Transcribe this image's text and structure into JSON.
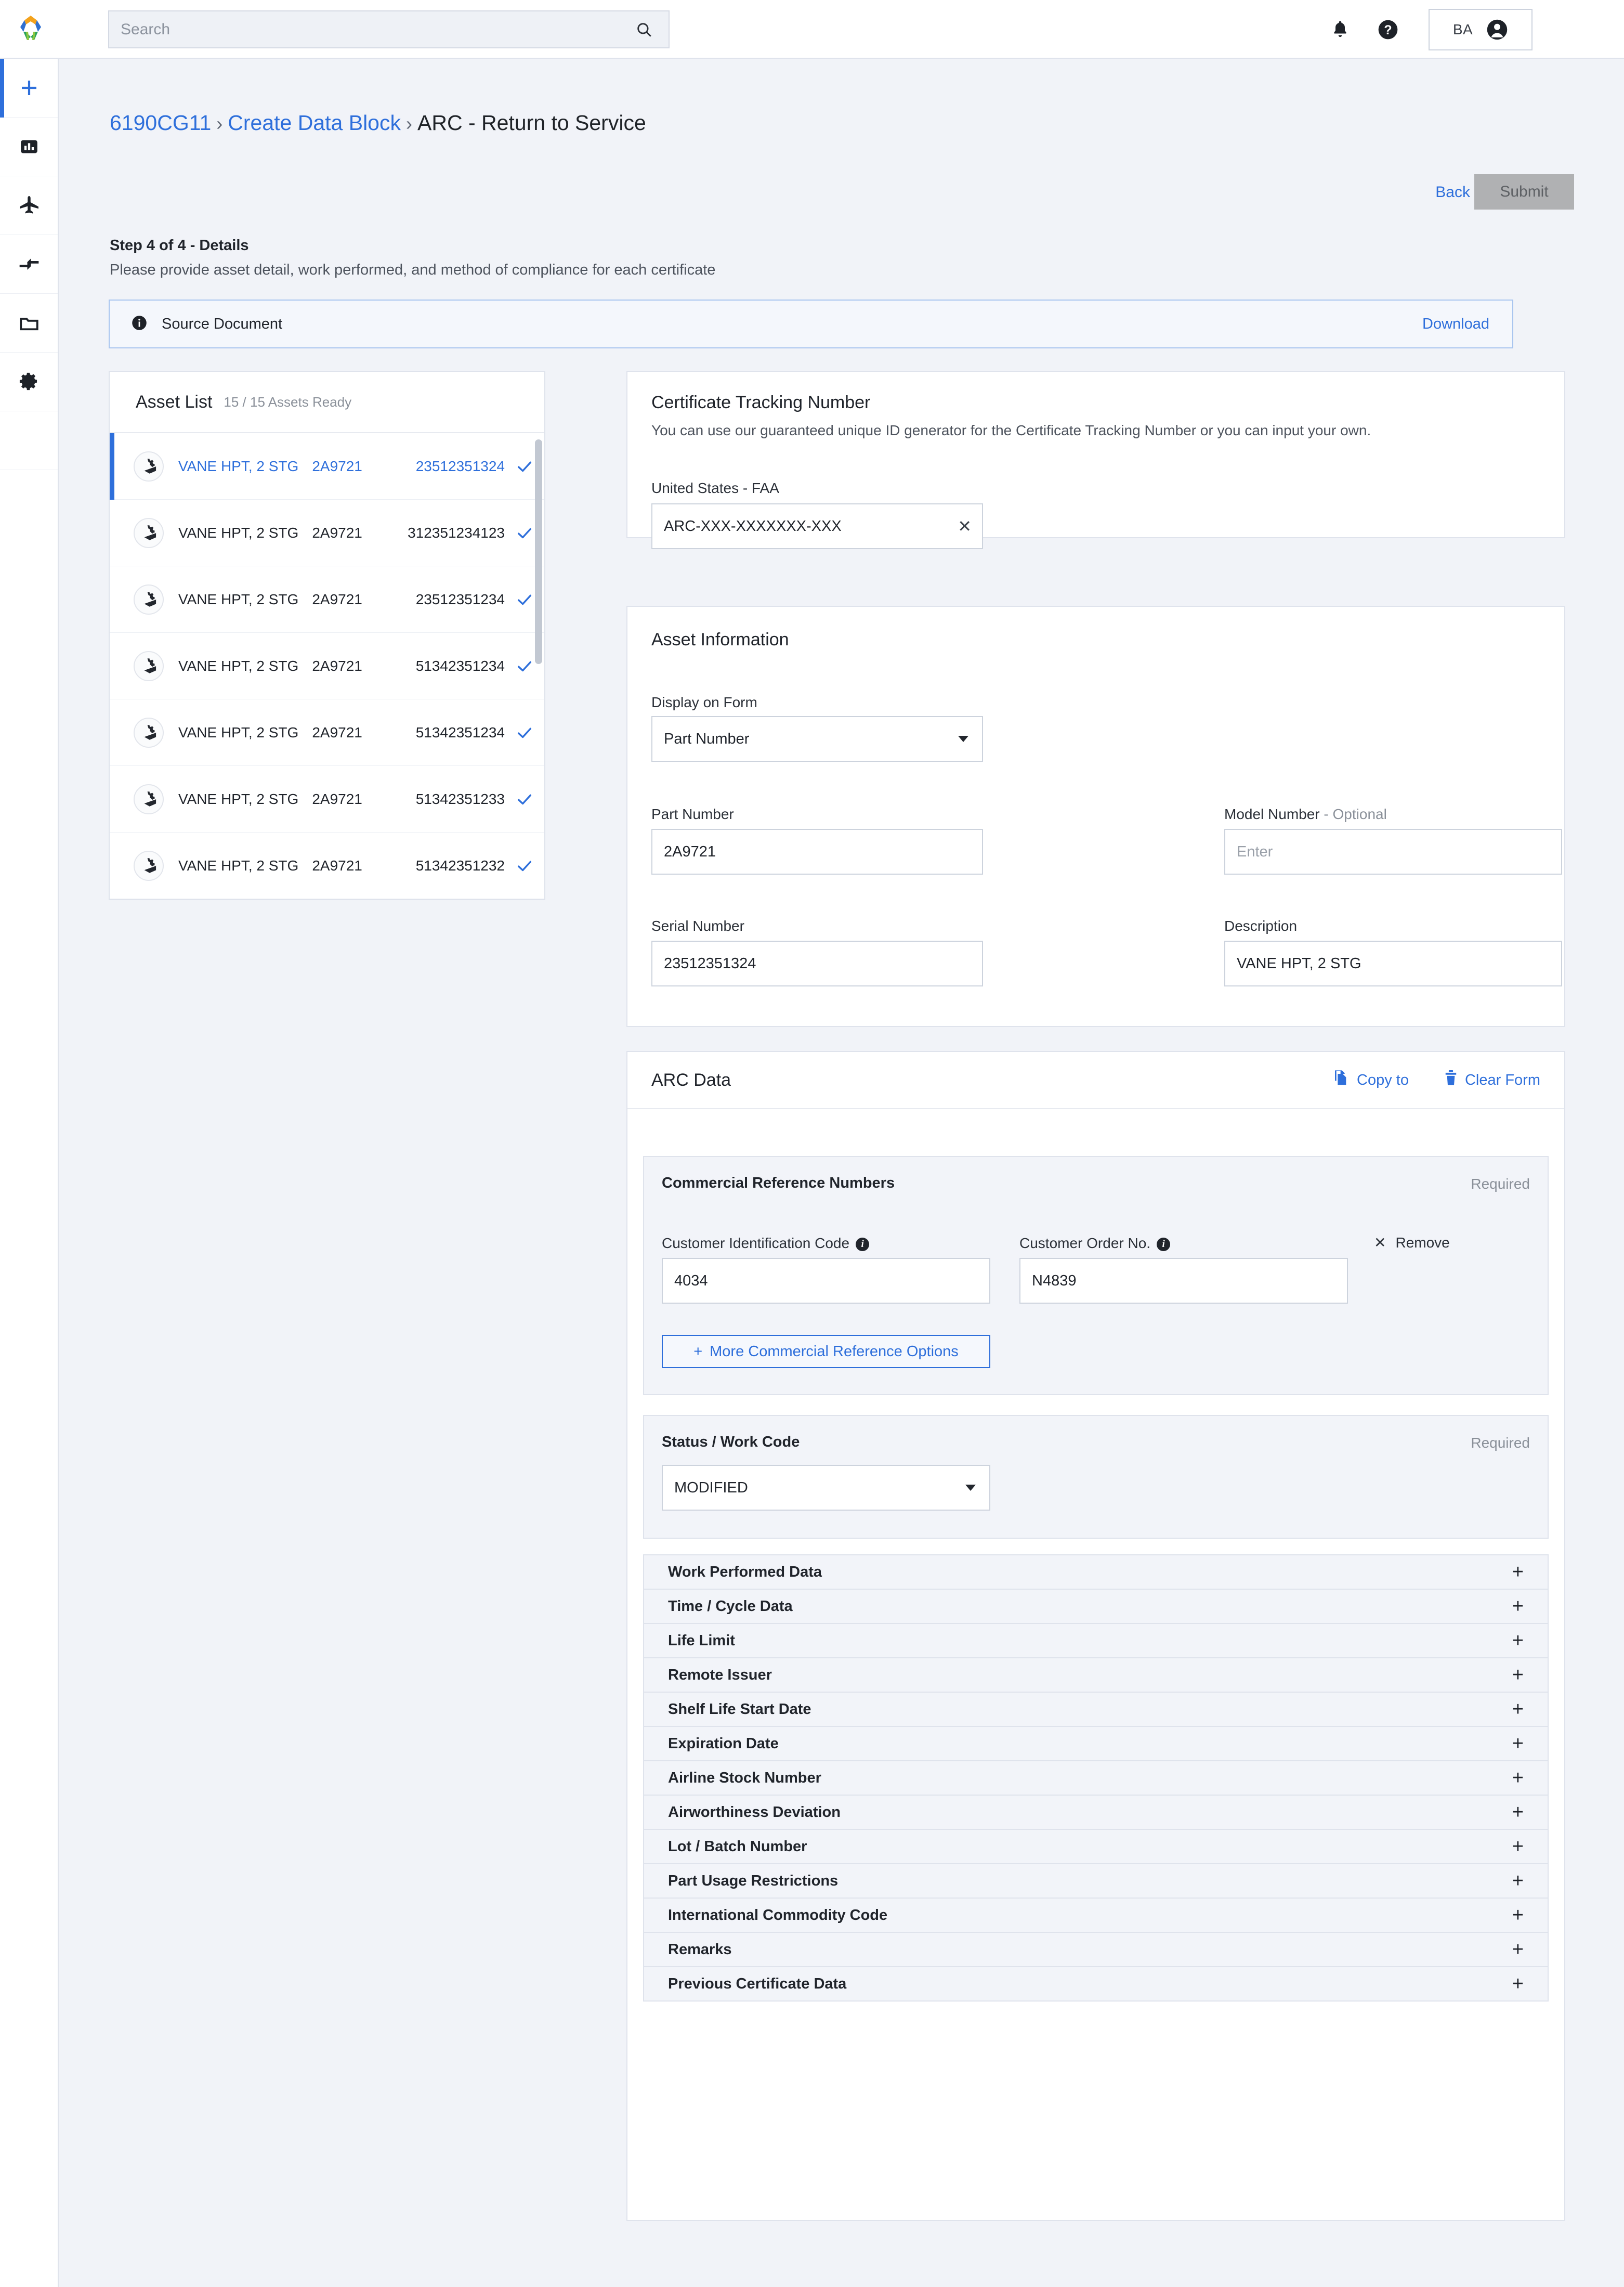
{
  "topbar": {
    "logo_icon": "brand-hexagon-logo",
    "search_placeholder": "Search",
    "search_value": "",
    "search_icon": "search-icon",
    "notifications_icon": "bell-icon",
    "help_icon": "help-circle-icon",
    "user_initials": "BA",
    "user_icon": "account-circle-icon"
  },
  "rail": {
    "items": [
      {
        "icon": "plus-icon",
        "name": "create"
      },
      {
        "icon": "bar-chart-icon",
        "name": "analytics"
      },
      {
        "icon": "airplane-icon",
        "name": "fleet"
      },
      {
        "icon": "transfer-icon",
        "name": "transfers"
      },
      {
        "icon": "folder-icon",
        "name": "documents"
      },
      {
        "icon": "gear-icon",
        "name": "settings"
      }
    ]
  },
  "breadcrumb": {
    "item1": "6190CG11",
    "sep": "›",
    "item2": "Create Data Block",
    "item3": "ARC - Return to Service"
  },
  "header_actions": {
    "back_label": "Back",
    "submit_label": "Submit"
  },
  "step": {
    "title": "Step 4 of 4 - Details",
    "subtitle": "Please provide asset detail, work performed, and method of compliance for each certificate"
  },
  "source_document": {
    "info_icon": "info-icon",
    "label": "Source Document",
    "download_label": "Download"
  },
  "asset_list": {
    "title": "Asset List",
    "count": "15 / 15 Assets Ready",
    "item_icon": "gear-part-icon",
    "check_icon": "check-icon",
    "rows": [
      {
        "description": "VANE HPT, 2 STG",
        "part_number": "2A9721",
        "serial_number": "23512351324",
        "ready": true,
        "selected": true
      },
      {
        "description": "VANE HPT, 2 STG",
        "part_number": "2A9721",
        "serial_number": "312351234123",
        "ready": true,
        "selected": false
      },
      {
        "description": "VANE HPT, 2 STG",
        "part_number": "2A9721",
        "serial_number": "23512351234",
        "ready": true,
        "selected": false
      },
      {
        "description": "VANE HPT, 2 STG",
        "part_number": "2A9721",
        "serial_number": "51342351234",
        "ready": true,
        "selected": false
      },
      {
        "description": "VANE HPT, 2 STG",
        "part_number": "2A9721",
        "serial_number": "51342351234",
        "ready": true,
        "selected": false
      },
      {
        "description": "VANE HPT, 2 STG",
        "part_number": "2A9721",
        "serial_number": "51342351233",
        "ready": true,
        "selected": false
      },
      {
        "description": "VANE HPT, 2 STG",
        "part_number": "2A9721",
        "serial_number": "51342351232",
        "ready": true,
        "selected": false
      }
    ]
  },
  "certificate_tracking": {
    "title": "Certificate Tracking Number",
    "helper": "You can use our guaranteed unique ID generator for the Certificate Tracking Number or you can input your own.",
    "field_label": "United States - FAA",
    "value": "ARC-XXX-XXXXXXX-XXX",
    "clear_icon": "close-icon"
  },
  "asset_information": {
    "title": "Asset Information",
    "display_on_form": {
      "label": "Display on Form",
      "value": "Part Number",
      "caret_icon": "chevron-down-icon"
    },
    "part_number": {
      "label": "Part Number",
      "value": "2A9721"
    },
    "model_number": {
      "label": "Model Number",
      "optional_suffix": " - Optional",
      "value": "",
      "placeholder": "Enter"
    },
    "serial_number": {
      "label": "Serial Number",
      "value": "23512351324"
    },
    "description": {
      "label": "Description",
      "value": "VANE HPT, 2 STG"
    }
  },
  "arc_data": {
    "title": "ARC Data",
    "copy_to": {
      "label": "Copy to",
      "icon": "copy-icon"
    },
    "clear_form": {
      "label": "Clear Form",
      "icon": "trash-icon"
    },
    "commercial_reference": {
      "title": "Commercial Reference Numbers",
      "required_label": "Required",
      "customer_identification_code": {
        "label": "Customer Identification Code",
        "info_icon": "info-icon",
        "value": "4034"
      },
      "customer_order_no": {
        "label": "Customer Order No.",
        "info_icon": "info-icon",
        "value": "N4839"
      },
      "remove": {
        "label": "Remove",
        "icon": "close-icon"
      },
      "more_options": {
        "label": "More Commercial Reference Options",
        "icon": "plus-icon"
      }
    },
    "status_work_code": {
      "title": "Status / Work Code",
      "required_label": "Required",
      "value": "MODIFIED",
      "caret_icon": "chevron-down-icon"
    },
    "accordions": [
      {
        "label": "Work Performed Data",
        "expand_icon": "plus-icon"
      },
      {
        "label": "Time / Cycle Data",
        "expand_icon": "plus-icon"
      },
      {
        "label": "Life Limit",
        "expand_icon": "plus-icon"
      },
      {
        "label": "Remote Issuer",
        "expand_icon": "plus-icon"
      },
      {
        "label": "Shelf Life Start Date",
        "expand_icon": "plus-icon"
      },
      {
        "label": "Expiration Date",
        "expand_icon": "plus-icon"
      },
      {
        "label": "Airline Stock Number",
        "expand_icon": "plus-icon"
      },
      {
        "label": "Airworthiness Deviation",
        "expand_icon": "plus-icon"
      },
      {
        "label": "Lot / Batch Number",
        "expand_icon": "plus-icon"
      },
      {
        "label": "Part Usage Restrictions",
        "expand_icon": "plus-icon"
      },
      {
        "label": "International Commodity Code",
        "expand_icon": "plus-icon"
      },
      {
        "label": "Remarks",
        "expand_icon": "plus-icon"
      },
      {
        "label": "Previous Certificate Data",
        "expand_icon": "plus-icon"
      }
    ]
  },
  "colors": {
    "accent": "#2e6fdb",
    "page_bg": "#f1f3f8",
    "panel_bg": "#ffffff",
    "subpanel_bg": "#f2f4f9",
    "border": "#dfe3ec",
    "text": "#20242b",
    "muted": "#8a9099",
    "submit_disabled": "#b0b1b3"
  }
}
